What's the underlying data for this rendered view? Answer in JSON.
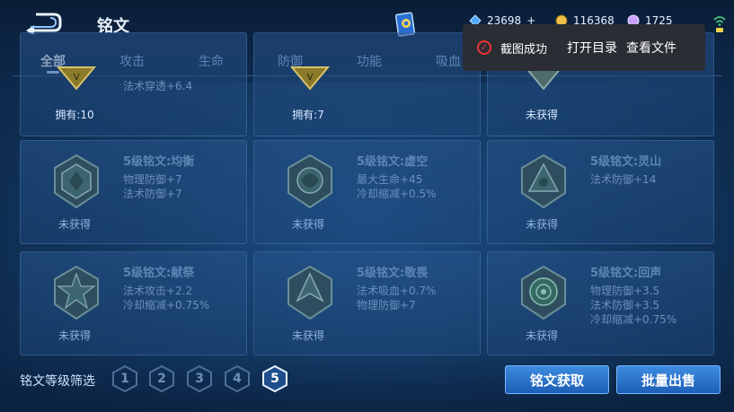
{
  "header": {
    "title": "铭文",
    "currencies": [
      {
        "icon": "diamond-icon",
        "value": "23698",
        "plus": "+",
        "color": "#4fa8ff"
      },
      {
        "icon": "gold-coin-icon",
        "value": "116368",
        "plus": "",
        "color": "#f1c04a"
      },
      {
        "icon": "crystal-icon",
        "value": "1725",
        "plus": "",
        "color": "#c9a0ff"
      }
    ]
  },
  "tabs": [
    {
      "label": "全部",
      "active": true
    },
    {
      "label": "攻击",
      "active": false
    },
    {
      "label": "生命",
      "active": false
    },
    {
      "label": "防御",
      "active": false
    },
    {
      "label": "功能",
      "active": false
    },
    {
      "label": "吸血",
      "active": false
    }
  ],
  "toast": {
    "message": "截图成功",
    "open_dir": "打开目录",
    "view_file": "查看文件"
  },
  "cards": [
    {
      "name": "",
      "stats": [
        "法术穿透+6.4"
      ],
      "owned": "拥有:10",
      "top": true
    },
    {
      "name": "",
      "stats": [],
      "owned": "拥有:7",
      "top": true
    },
    {
      "name": "",
      "stats": [],
      "owned": "未获得",
      "top": true
    },
    {
      "name": "5级铭文:均衡",
      "stats": [
        "物理防御+7",
        "法术防御+7"
      ],
      "owned": "未获得"
    },
    {
      "name": "5级铭文:虚空",
      "stats": [
        "最大生命+45",
        "冷却缩减+0.5%"
      ],
      "owned": "未获得"
    },
    {
      "name": "5级铭文:灵山",
      "stats": [
        "法术防御+14"
      ],
      "owned": "未获得"
    },
    {
      "name": "5级铭文:献祭",
      "stats": [
        "法术攻击+2.2",
        "冷却缩减+0.75%"
      ],
      "owned": "未获得"
    },
    {
      "name": "5级铭文:敬畏",
      "stats": [
        "法术吸血+0.7%",
        "物理防御+7"
      ],
      "owned": "未获得"
    },
    {
      "name": "5级铭文:回声",
      "stats": [
        "物理防御+3.5",
        "法术防御+3.5",
        "冷却缩减+0.75%"
      ],
      "owned": "未获得"
    }
  ],
  "footer": {
    "filter_label": "铭文等级筛选",
    "levels": [
      "1",
      "2",
      "3",
      "4",
      "5"
    ],
    "active_level": "5",
    "obtain_button": "铭文获取",
    "bulk_sell_button": "批量出售"
  }
}
